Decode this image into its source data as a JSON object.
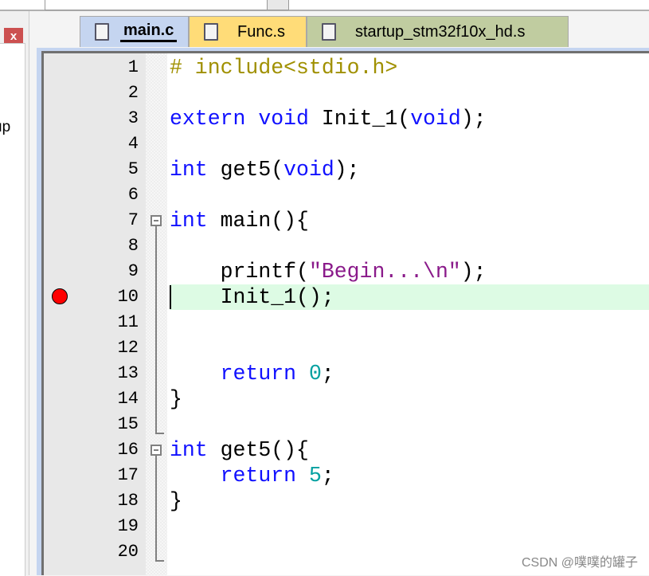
{
  "left_panel": {
    "close_label": "x",
    "partial_label": "up"
  },
  "tabs": [
    {
      "label": "main.c",
      "color": "#c5d5f0",
      "active": true
    },
    {
      "label": "Func.s",
      "color": "#ffdc78",
      "active": false
    },
    {
      "label": "startup_stm32f10x_hd.s",
      "color": "#c0cca0",
      "active": false
    }
  ],
  "editor": {
    "breakpoint_line": 10,
    "current_line": 10,
    "lines": [
      {
        "n": "1",
        "tokens": [
          [
            "# include<stdio.h>",
            "pp"
          ]
        ]
      },
      {
        "n": "2",
        "tokens": []
      },
      {
        "n": "3",
        "tokens": [
          [
            "extern",
            "kw"
          ],
          [
            " "
          ],
          [
            "void",
            "kw"
          ],
          [
            " Init_1("
          ],
          [
            "void",
            "kw"
          ],
          [
            ");"
          ]
        ]
      },
      {
        "n": "4",
        "tokens": []
      },
      {
        "n": "5",
        "tokens": [
          [
            "int",
            "kw"
          ],
          [
            " get5("
          ],
          [
            "void",
            "kw"
          ],
          [
            ");"
          ]
        ]
      },
      {
        "n": "6",
        "tokens": []
      },
      {
        "n": "7",
        "tokens": [
          [
            "int",
            "kw"
          ],
          [
            " main(){"
          ]
        ]
      },
      {
        "n": "8",
        "tokens": []
      },
      {
        "n": "9",
        "tokens": [
          [
            "    printf("
          ],
          [
            "\"Begin...\\n\"",
            "str"
          ],
          [
            ");"
          ]
        ]
      },
      {
        "n": "10",
        "tokens": [
          [
            "    Init_1();"
          ]
        ]
      },
      {
        "n": "11",
        "tokens": []
      },
      {
        "n": "12",
        "tokens": []
      },
      {
        "n": "13",
        "tokens": [
          [
            "    "
          ],
          [
            "return",
            "kw"
          ],
          [
            " "
          ],
          [
            "0",
            "num"
          ],
          [
            ";"
          ]
        ]
      },
      {
        "n": "14",
        "tokens": [
          [
            "}"
          ]
        ]
      },
      {
        "n": "15",
        "tokens": []
      },
      {
        "n": "16",
        "tokens": [
          [
            "int",
            "kw"
          ],
          [
            " get5(){"
          ]
        ]
      },
      {
        "n": "17",
        "tokens": [
          [
            "    "
          ],
          [
            "return",
            "kw"
          ],
          [
            " "
          ],
          [
            "5",
            "num"
          ],
          [
            ";"
          ]
        ]
      },
      {
        "n": "18",
        "tokens": [
          [
            "}"
          ]
        ]
      },
      {
        "n": "19",
        "tokens": []
      },
      {
        "n": "20",
        "tokens": []
      }
    ]
  },
  "watermark": "CSDN @噗噗的罐子"
}
